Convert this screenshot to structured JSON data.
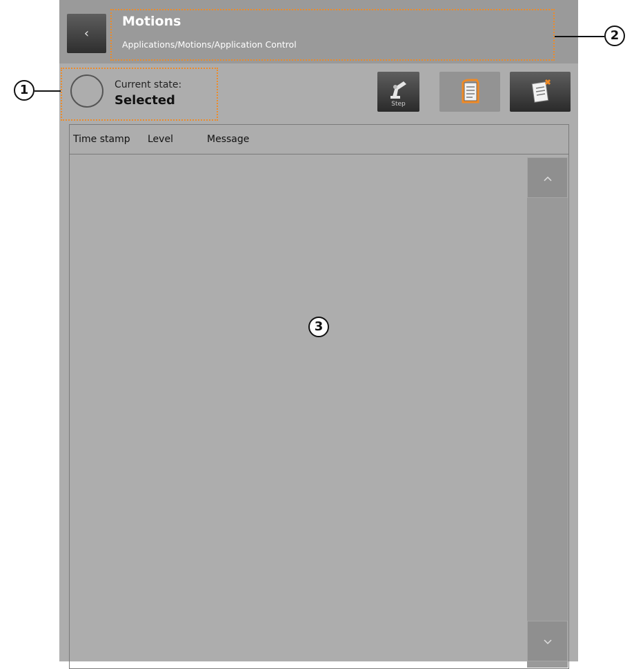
{
  "header": {
    "back_label": "‹",
    "title": "Motions",
    "breadcrumb": "Applications/Motions/Application Control"
  },
  "status": {
    "label": "Current state:",
    "value": "Selected"
  },
  "toolbar": {
    "step_label": "Step",
    "step_icon": "robot-arm-icon",
    "log_icon": "log-document-icon",
    "clear_icon": "clear-log-icon"
  },
  "log_table": {
    "columns": [
      "Time stamp",
      "Level",
      "Message"
    ],
    "rows": []
  },
  "scrollbar": {
    "up_label": "^",
    "down_label": "⌄"
  },
  "callouts": [
    "1",
    "2",
    "3"
  ],
  "colors": {
    "highlight": "#f08a24",
    "panel": "#adadad",
    "header": "#9a9a9a"
  }
}
